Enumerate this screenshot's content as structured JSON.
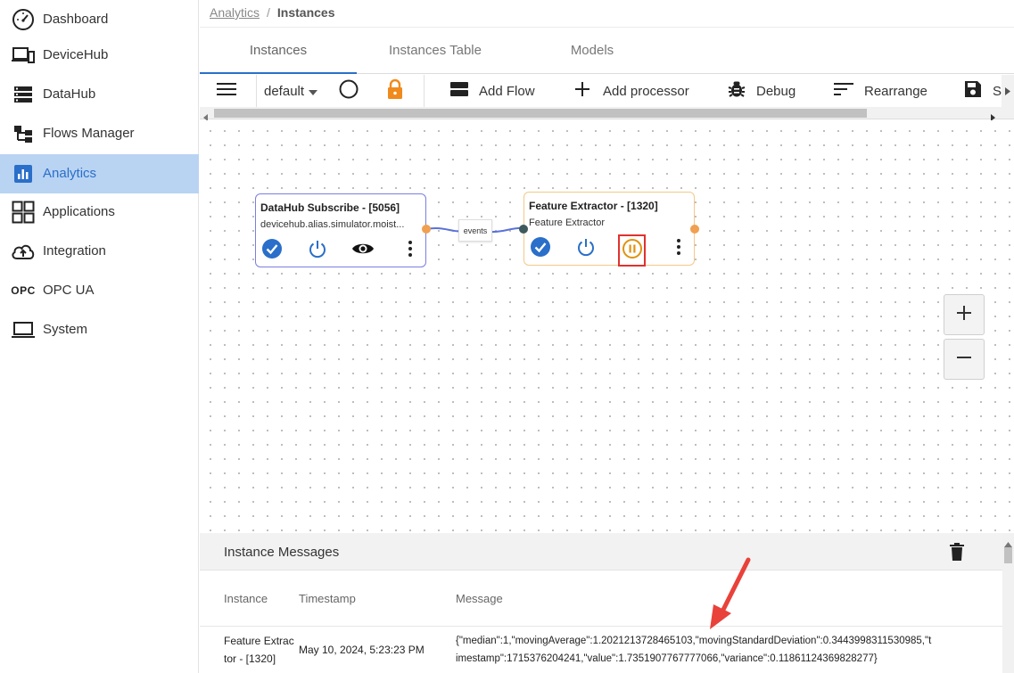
{
  "sidebar": {
    "items": [
      {
        "label": "Dashboard",
        "icon": "dashboard-icon"
      },
      {
        "label": "DeviceHub",
        "icon": "devices-icon"
      },
      {
        "label": "DataHub",
        "icon": "storage-icon"
      },
      {
        "label": "Flows Manager",
        "icon": "flow-tree-icon"
      },
      {
        "label": "Analytics",
        "icon": "analytics-icon",
        "active": true
      },
      {
        "label": "Applications",
        "icon": "apps-grid-icon"
      },
      {
        "label": "Integration",
        "icon": "cloud-upload-icon"
      },
      {
        "label": "OPC UA",
        "icon": "opc-text-icon",
        "icon_text": "OPC"
      },
      {
        "label": "System",
        "icon": "laptop-icon"
      }
    ]
  },
  "breadcrumb": {
    "parent": "Analytics",
    "separator": "/",
    "current": "Instances"
  },
  "tabs": [
    {
      "label": "Instances",
      "active": true
    },
    {
      "label": "Instances Table"
    },
    {
      "label": "Models"
    }
  ],
  "toolbar": {
    "flow_select": "default",
    "add_flow": "Add Flow",
    "add_processor": "Add processor",
    "debug": "Debug",
    "rearrange": "Rearrange",
    "save_partial": "S"
  },
  "flow": {
    "node1": {
      "title": "DataHub Subscribe - [5056]",
      "subtitle": "devicehub.alias.simulator.moist..."
    },
    "node2": {
      "title": "Feature Extractor - [1320]",
      "subtitle": "Feature Extractor"
    },
    "edge_label": "events"
  },
  "messages": {
    "title": "Instance Messages",
    "columns": [
      "Instance",
      "Timestamp",
      "Message"
    ],
    "rows": [
      {
        "instance_line1": "Feature Extrac",
        "instance_line2": "tor - [1320]",
        "timestamp": "May 10, 2024, 5:23:23 PM",
        "message_line1": "{\"median\":1,\"movingAverage\":1.2021213728465103,\"movingStandardDeviation\":0.3443998311530985,\"t",
        "message_line2": "imestamp\":1715376204241,\"value\":1.7351907767777066,\"variance\":0.11861124369828277}"
      }
    ]
  },
  "colors": {
    "accent": "#2a6fc9",
    "active_bg": "#b9d3f3",
    "node1_border": "#7b7fe0",
    "node2_border": "#f3c98a",
    "port_orange": "#f0a050",
    "highlight_red": "#e0322d",
    "pause_orange": "#e0920f",
    "lock_orange": "#f08a1c"
  }
}
